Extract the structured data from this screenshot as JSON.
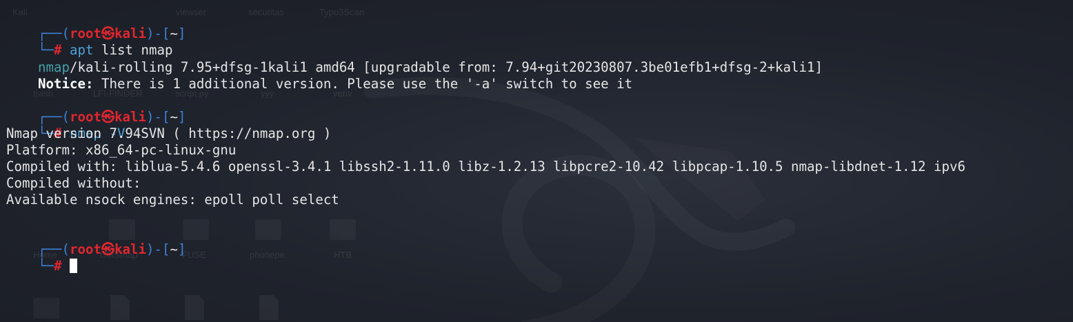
{
  "desktop": {
    "labels": [
      "Kali",
      "viewser",
      "securitas",
      "Typo3Scan",
      "trash",
      "LFI-FINDER",
      "script.py",
      "yyy",
      "venv",
      "Home",
      "CMSmap",
      "FUSE",
      "phonepe",
      "HTB"
    ]
  },
  "prompt": {
    "corner_top": "┌──",
    "open_paren": "(",
    "user": "root",
    "at": "㉿",
    "host": "kali",
    "close_dash": ")-[",
    "dir": "~",
    "close_bracket": "]",
    "corner_bottom": "└─",
    "hash": "#"
  },
  "blocks": [
    {
      "command": "apt",
      "args": " list nmap",
      "output": {
        "pkg_name": "nmap",
        "pkg_rest": "/kali-rolling 7.95+dfsg-1kali1 amd64 [upgradable from: 7.94+git20230807.3be01efb1+dfsg-2+kali1]",
        "notice_label": "Notice:",
        "notice_text": " There is 1 additional version. Please use the '-a' switch to see it"
      }
    },
    {
      "command": "nmap",
      "args": " -V",
      "output_lines": [
        "Nmap version 7.94SVN ( https://nmap.org )",
        "Platform: x86_64-pc-linux-gnu",
        "Compiled with: liblua-5.4.6 openssl-3.4.1 libssh2-1.11.0 libz-1.2.13 libpcre2-10.42 libpcap-1.10.5 nmap-libdnet-1.12 ipv6",
        "Compiled without:",
        "Available nsock engines: epoll poll select"
      ]
    }
  ],
  "colors": {
    "background": "#1e222b",
    "prompt_frame": "#3d82d6",
    "prompt_user_host": "#e0262f",
    "command": "#4aa3d8",
    "package_name": "#46a0a8",
    "text": "#e6e6e6"
  }
}
